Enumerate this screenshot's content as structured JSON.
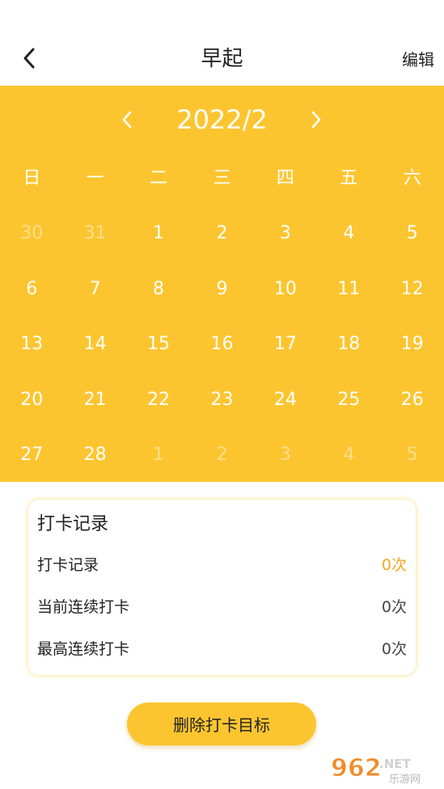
{
  "header": {
    "title": "早起",
    "edit_label": "编辑"
  },
  "calendar": {
    "month_label": "2022/2",
    "weekdays": [
      "日",
      "一",
      "二",
      "三",
      "四",
      "五",
      "六"
    ],
    "weeks": [
      [
        {
          "d": "30",
          "muted": true
        },
        {
          "d": "31",
          "muted": true
        },
        {
          "d": "1"
        },
        {
          "d": "2"
        },
        {
          "d": "3"
        },
        {
          "d": "4"
        },
        {
          "d": "5"
        }
      ],
      [
        {
          "d": "6"
        },
        {
          "d": "7"
        },
        {
          "d": "8"
        },
        {
          "d": "9"
        },
        {
          "d": "10"
        },
        {
          "d": "11"
        },
        {
          "d": "12"
        }
      ],
      [
        {
          "d": "13"
        },
        {
          "d": "14"
        },
        {
          "d": "15"
        },
        {
          "d": "16"
        },
        {
          "d": "17"
        },
        {
          "d": "18"
        },
        {
          "d": "19"
        }
      ],
      [
        {
          "d": "20"
        },
        {
          "d": "21"
        },
        {
          "d": "22"
        },
        {
          "d": "23"
        },
        {
          "d": "24"
        },
        {
          "d": "25"
        },
        {
          "d": "26"
        }
      ],
      [
        {
          "d": "27"
        },
        {
          "d": "28"
        },
        {
          "d": "1",
          "muted": true
        },
        {
          "d": "2",
          "muted": true
        },
        {
          "d": "3",
          "muted": true
        },
        {
          "d": "4",
          "muted": true
        },
        {
          "d": "5",
          "muted": true
        }
      ]
    ]
  },
  "stats": {
    "title": "打卡记录",
    "rows": [
      {
        "label": "打卡记录",
        "value": "0次",
        "highlight": true
      },
      {
        "label": "当前连续打卡",
        "value": "0次"
      },
      {
        "label": "最高连续打卡",
        "value": "0次"
      }
    ]
  },
  "actions": {
    "delete_label": "删除打卡目标"
  },
  "watermark": {
    "brand": "962",
    "suffix": ".NET",
    "tagline": "乐游网"
  },
  "colors": {
    "accent": "#FCC530",
    "highlight": "#F5A623"
  },
  "icons": {
    "back": "chevron-left-icon",
    "prev_month": "chevron-left-icon",
    "next_month": "chevron-right-icon"
  }
}
